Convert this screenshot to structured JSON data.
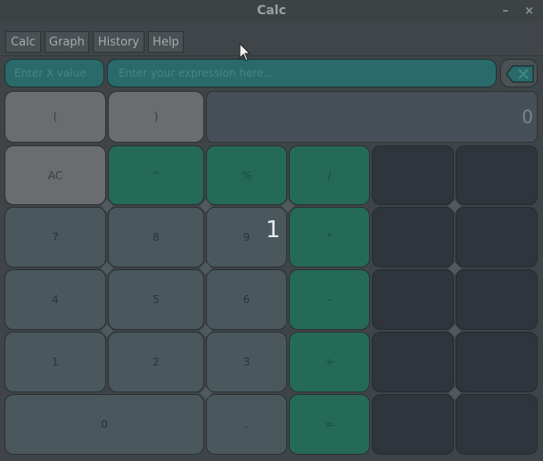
{
  "window": {
    "title": "Calc",
    "minimize": "–",
    "close": "×"
  },
  "menu": {
    "tabs": [
      "Calc",
      "Graph",
      "History",
      "Help"
    ]
  },
  "inputs": {
    "x_value_placeholder": "Enter X value",
    "expression_placeholder": "Enter your expression here..."
  },
  "display": {
    "value": "0"
  },
  "overlay": {
    "value": "1"
  },
  "keys": {
    "lparen": "(",
    "rparen": ")",
    "ac": "AC",
    "pow": "^",
    "percent": "%",
    "divide": "/",
    "n7": "7",
    "n8": "8",
    "n9": "9",
    "multiply": "*",
    "n4": "4",
    "n5": "5",
    "n6": "6",
    "minus": "-",
    "n1": "1",
    "n2": "2",
    "n3": "3",
    "plus": "+",
    "n0": "0",
    "dot": ".",
    "equals": "="
  },
  "colors": {
    "teal": "#246a56",
    "slate": "#4a585d",
    "gray": "#6a6c6f",
    "dark": "#2f353c"
  }
}
